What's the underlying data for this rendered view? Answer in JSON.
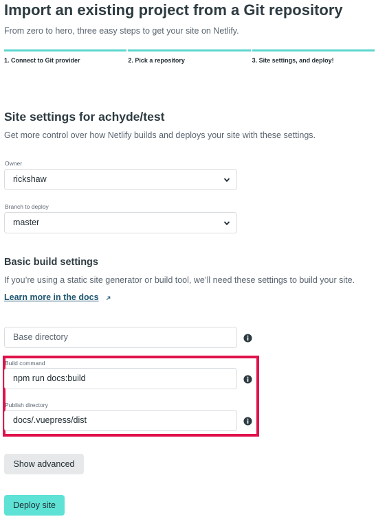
{
  "header": {
    "title": "Import an existing project from a Git repository",
    "subtitle": "From zero to hero, three easy steps to get your site on Netlify."
  },
  "steps": [
    {
      "label": "1. Connect to Git provider"
    },
    {
      "label": "2. Pick a repository"
    },
    {
      "label": "3. Site settings, and deploy!"
    }
  ],
  "site_settings": {
    "title": "Site settings for achyde/test",
    "description": "Get more control over how Netlify builds and deploys your site with these settings.",
    "owner": {
      "label": "Owner",
      "value": "rickshaw"
    },
    "branch": {
      "label": "Branch to deploy",
      "value": "master"
    }
  },
  "build_settings": {
    "title": "Basic build settings",
    "description": "If you’re using a static site generator or build tool, we’ll need these settings to build your site.",
    "docs_link": "Learn more in the docs",
    "base_directory": {
      "placeholder": "Base directory",
      "value": ""
    },
    "build_command": {
      "label": "Build command",
      "value": "npm run docs:build"
    },
    "publish_directory": {
      "label": "Publish directory",
      "value": "docs/.vuepress/dist"
    }
  },
  "buttons": {
    "show_advanced": "Show advanced",
    "deploy": "Deploy site"
  },
  "colors": {
    "accent": "#5bd6cf",
    "primary_button": "#5ee2d6",
    "highlight": "#e0124b",
    "link": "#1f5671"
  }
}
